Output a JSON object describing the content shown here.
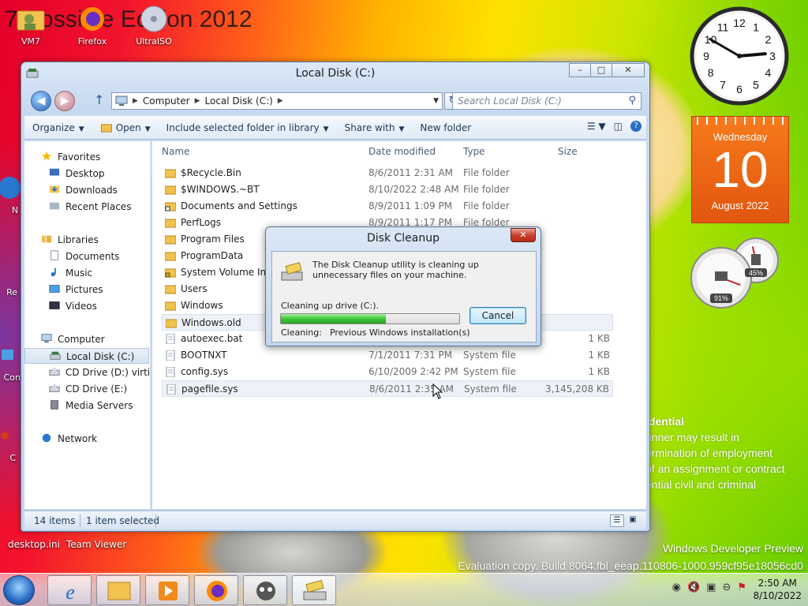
{
  "desktop": {
    "banner": "7 Possible Edition 2012",
    "top_icons": [
      {
        "label": "VM7",
        "icon": "folder-user-icon"
      },
      {
        "label": "Firefox",
        "icon": "firefox-icon"
      },
      {
        "label": "UltraISO",
        "icon": "disc-icon"
      }
    ],
    "left_edge_labels": [
      "Co",
      "N",
      "Re",
      "Con",
      "C"
    ],
    "bottom_labels": [
      "desktop.ini",
      "Team Viewer"
    ],
    "confidential": {
      "heading": "idential",
      "lines": [
        "anner may result in",
        "ermination of employment",
        "of an assignment or contract",
        "ential civil and criminal"
      ]
    },
    "watermark": {
      "line1": "Windows Developer Preview",
      "line2": "Evaluation copy. Build 8064.fbl_eeap.110806-1000.959cf95e18056cd0"
    }
  },
  "gadgets": {
    "clock": {
      "hour": 2,
      "minute": 50
    },
    "calendar": {
      "weekday": "Wednesday",
      "day": "10",
      "month_year": "August 2022"
    },
    "meters": {
      "cpu_percent": 91,
      "memory_percent": 45,
      "cpu_label": "91%",
      "memory_label": "45%"
    }
  },
  "explorer": {
    "title": "Local Disk (C:)",
    "caption_buttons": {
      "minimize": "–",
      "maximize": "□",
      "close": "✕"
    },
    "breadcrumb": [
      "Computer",
      "Local Disk (C:)"
    ],
    "search_placeholder": "Search Local Disk (C:)",
    "toolbar": {
      "organize": "Organize",
      "open": "Open",
      "include": "Include selected folder in library",
      "share": "Share with",
      "new_folder": "New folder"
    },
    "nav": {
      "favorites": "Favorites",
      "favorites_items": [
        "Desktop",
        "Downloads",
        "Recent Places"
      ],
      "libraries": "Libraries",
      "libraries_items": [
        "Documents",
        "Music",
        "Pictures",
        "Videos"
      ],
      "computer": "Computer",
      "computer_items": [
        "Local Disk (C:)",
        "CD Drive (D:) virtio-w",
        "CD Drive (E:)",
        "Media Servers"
      ],
      "network": "Network"
    },
    "columns": {
      "name": "Name",
      "date": "Date modified",
      "type": "Type",
      "size": "Size"
    },
    "files": [
      {
        "name": "$Recycle.Bin",
        "date": "8/6/2011 2:31 AM",
        "type": "File folder",
        "size": "",
        "kind": "folder"
      },
      {
        "name": "$WINDOWS.~BT",
        "date": "8/10/2022 2:48 AM",
        "type": "File folder",
        "size": "",
        "kind": "folder"
      },
      {
        "name": "Documents and Settings",
        "date": "8/9/2011 1:09 PM",
        "type": "File folder",
        "size": "",
        "kind": "shortcut"
      },
      {
        "name": "PerfLogs",
        "date": "8/9/2011 1:17 PM",
        "type": "File folder",
        "size": "",
        "kind": "folder"
      },
      {
        "name": "Program Files",
        "date": "",
        "type": "File folder",
        "size": "",
        "kind": "folder"
      },
      {
        "name": "ProgramData",
        "date": "",
        "type": "",
        "size": "",
        "kind": "folder"
      },
      {
        "name": "System Volume Info",
        "date": "",
        "type": "",
        "size": "",
        "kind": "lockfolder"
      },
      {
        "name": "Users",
        "date": "",
        "type": "",
        "size": "",
        "kind": "folder"
      },
      {
        "name": "Windows",
        "date": "",
        "type": "",
        "size": "",
        "kind": "folder"
      },
      {
        "name": "Windows.old",
        "date": "",
        "type": "",
        "size": "",
        "kind": "folder"
      },
      {
        "name": "autoexec.bat",
        "date": "",
        "type": "",
        "size": "1 KB",
        "kind": "file"
      },
      {
        "name": "BOOTNXT",
        "date": "7/1/2011 7:31 PM",
        "type": "System file",
        "size": "1 KB",
        "kind": "file"
      },
      {
        "name": "config.sys",
        "date": "6/10/2009 2:42 PM",
        "type": "System file",
        "size": "1 KB",
        "kind": "file"
      },
      {
        "name": "pagefile.sys",
        "date": "8/6/2011 2:35 AM",
        "type": "System file",
        "size": "3,145,208 KB",
        "kind": "file"
      }
    ],
    "status": {
      "count": "14 items",
      "selected": "1 item selected"
    }
  },
  "dialog": {
    "title": "Disk Cleanup",
    "close": "✕",
    "message": "The Disk Cleanup utility is cleaning up unnecessary files on your machine.",
    "progress_label": "Cleaning up drive  (C:).",
    "progress": 0.59,
    "cleaning_label": "Cleaning:",
    "cleaning_value": "Previous Windows installation(s)",
    "cancel": "Cancel"
  },
  "taskbar": {
    "time": "2:50 AM",
    "date": "8/10/2022",
    "buttons": [
      "internet-explorer-icon",
      "explorer-icon",
      "media-player-icon",
      "firefox-icon",
      "teamviewer-icon",
      "disk-cleanup-icon"
    ]
  }
}
